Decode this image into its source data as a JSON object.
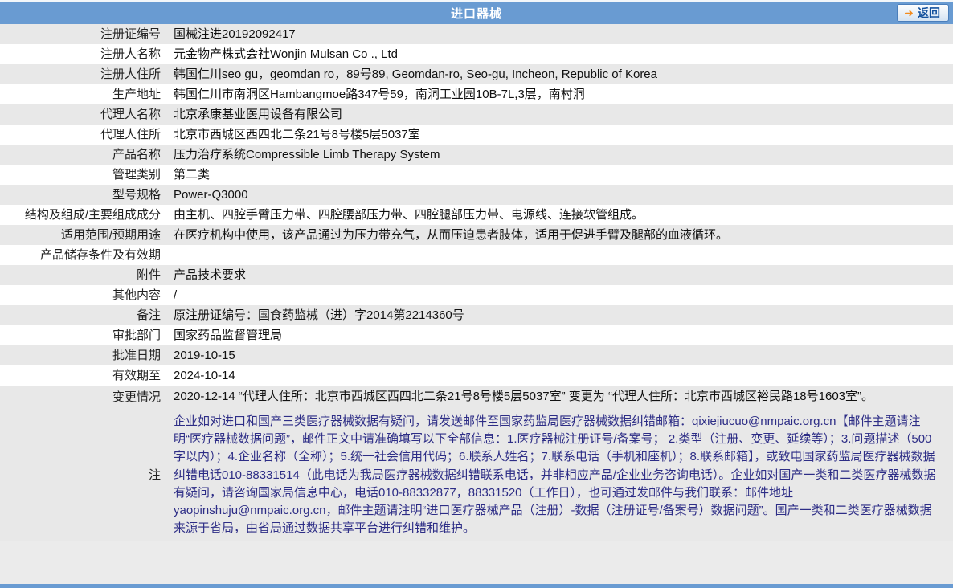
{
  "header": {
    "title": "进口器械",
    "back_button": {
      "label": "返回",
      "arrow_icon": "➜"
    }
  },
  "colors": {
    "header_blue": "#699bd2",
    "row_shaded": "#e8e8e8",
    "row_plain": "#ffffff",
    "note_text_navy": "#2d2d86",
    "back_text_blue": "#15529e",
    "back_arrow_orange": "#f28b1e"
  },
  "table": {
    "rows": [
      {
        "label": "注册证编号",
        "value": "国械注进20192092417"
      },
      {
        "label": "注册人名称",
        "value": "元金物产株式会社Wonjin Mulsan Co ., Ltd"
      },
      {
        "label": "注册人住所",
        "value": "韩国仁川seo gu，geomdan ro，89号89, Geomdan-ro, Seo-gu, Incheon, Republic of Korea"
      },
      {
        "label": "生产地址",
        "value": "韩国仁川市南洞区Hambangmoe路347号59，南洞工业园10B-7L,3层，南村洞"
      },
      {
        "label": "代理人名称",
        "value": "北京承康基业医用设备有限公司"
      },
      {
        "label": "代理人住所",
        "value": "北京市西城区西四北二条21号8号楼5层5037室"
      },
      {
        "label": "产品名称",
        "value": "压力治疗系统Compressible Limb Therapy System"
      },
      {
        "label": "管理类别",
        "value": "第二类"
      },
      {
        "label": "型号规格",
        "value": "Power-Q3000"
      },
      {
        "label": "结构及组成/主要组成成分",
        "value": "由主机、四腔手臂压力带、四腔腰部压力带、四腔腿部压力带、电源线、连接软管组成。"
      },
      {
        "label": "适用范围/预期用途",
        "value": "在医疗机构中使用，该产品通过为压力带充气，从而压迫患者肢体，适用于促进手臂及腿部的血液循环。"
      },
      {
        "label": "产品储存条件及有效期",
        "value": ""
      },
      {
        "label": "附件",
        "value": "产品技术要求"
      },
      {
        "label": "其他内容",
        "value": "/"
      },
      {
        "label": "备注",
        "value": "原注册证编号：国食药监械（进）字2014第2214360号"
      },
      {
        "label": "审批部门",
        "value": "国家药品监督管理局"
      },
      {
        "label": "批准日期",
        "value": "2019-10-15"
      },
      {
        "label": "有效期至",
        "value": "2024-10-14"
      },
      {
        "label": "变更情况",
        "value": "2020-12-14  “代理人住所：北京市西城区西四北二条21号8号楼5层5037室” 变更为 “代理人住所：北京市西城区裕民路18号1603室”。",
        "multiline": true
      }
    ]
  },
  "note_row": {
    "label": "注",
    "value": "企业如对进口和国产三类医疗器械数据有疑问，请发送邮件至国家药监局医疗器械数据纠错邮箱：qixiejiucuo@nmpaic.org.cn【邮件主题请注明“医疗器械数据问题”，邮件正文中请准确填写以下全部信息：1.医疗器械注册证号/备案号； 2.类型（注册、变更、延续等）；3.问题描述（500字以内）；4.企业名称（全称）；5.统一社会信用代码；6.联系人姓名；7.联系电话（手机和座机）；8.联系邮箱】，或致电国家药监局医疗器械数据纠错电话010-88331514（此电话为我局医疗器械数据纠错联系电话，并非相应产品/企业业务咨询电话）。企业如对国产一类和二类医疗器械数据有疑问，请咨询国家局信息中心，电话010-88332877，88331520（工作日），也可通过发邮件与我们联系：邮件地址yaopinshuju@nmpaic.org.cn，邮件主题请注明“进口医疗器械产品（注册）-数据（注册证号/备案号）数据问题”。国产一类和二类医疗器械数据来源于省局，由省局通过数据共享平台进行纠错和维护。"
  }
}
